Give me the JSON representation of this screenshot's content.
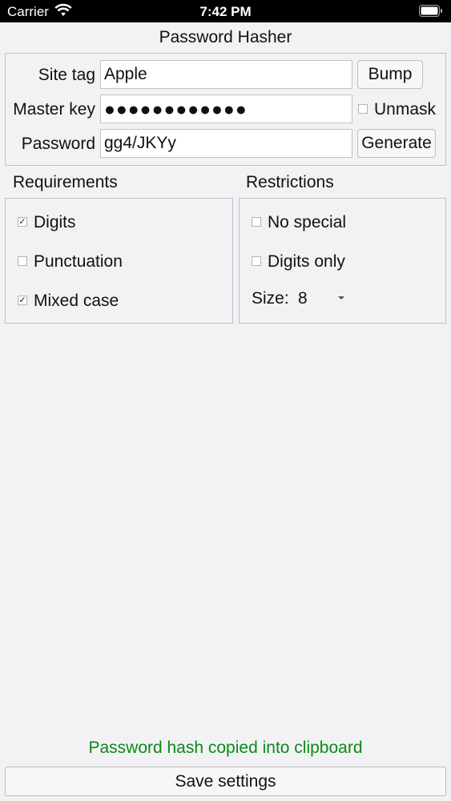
{
  "status_bar": {
    "carrier": "Carrier",
    "time": "7:42 PM"
  },
  "app": {
    "title": "Password Hasher"
  },
  "form": {
    "site_tag_label": "Site tag",
    "site_tag_value": "Apple",
    "bump_label": "Bump",
    "master_key_label": "Master key",
    "master_key_masked": "●●●●●●●●●●●●",
    "unmask_label": "Unmask",
    "unmask_checked": false,
    "password_label": "Password",
    "password_value": "gg4/JKYy",
    "generate_label": "Generate"
  },
  "requirements": {
    "heading": "Requirements",
    "digits": {
      "label": "Digits",
      "checked": true
    },
    "punctuation": {
      "label": "Punctuation",
      "checked": false
    },
    "mixed_case": {
      "label": "Mixed case",
      "checked": true
    }
  },
  "restrictions": {
    "heading": "Restrictions",
    "no_special": {
      "label": "No special",
      "checked": false
    },
    "digits_only": {
      "label": "Digits only",
      "checked": false
    },
    "size_label": "Size:",
    "size_value": "8"
  },
  "footer": {
    "message": "Password hash copied into clipboard",
    "message_color": "#0a8a17",
    "save_label": "Save settings"
  }
}
